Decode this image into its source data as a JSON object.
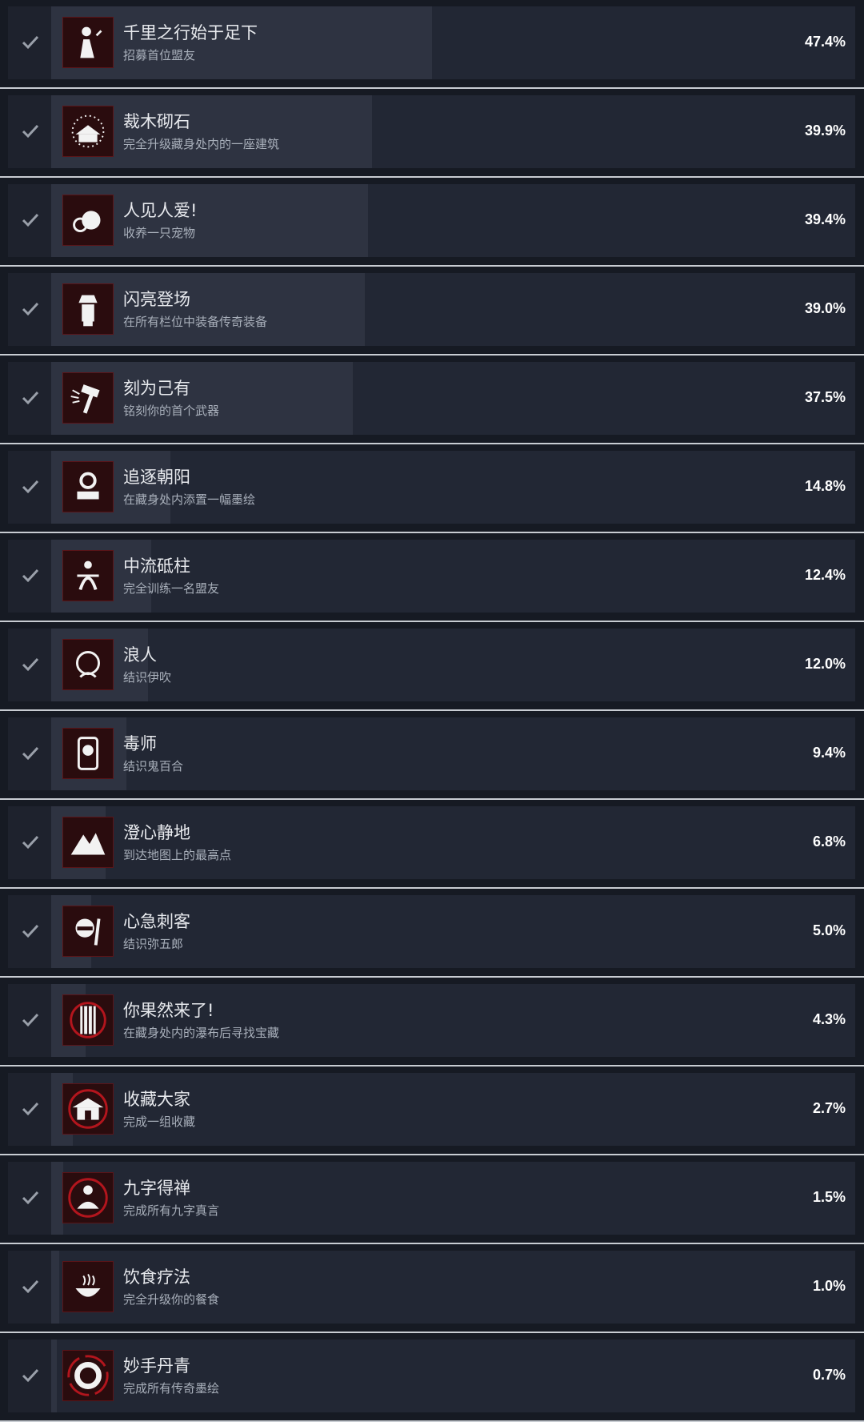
{
  "colors": {
    "row_background": "#161a23",
    "bar_track": "#222734",
    "bar_fill": "#2e3341",
    "icon_background": "#2a0c0e",
    "icon_accent": "#b3151d",
    "separator": "#c8ccd2",
    "title_text": "#e8eaee",
    "description_text": "#a9b0bb",
    "percent_text": "#ffffff"
  },
  "achievements": [
    {
      "title": "千里之行始于足下",
      "description": "招募首位盟友",
      "percent_label": "47.4%",
      "percent": 47.4,
      "icon": "recruit-figure-icon",
      "unlocked": true
    },
    {
      "title": "裁木砌石",
      "description": "完全升级藏身处内的一座建筑",
      "percent_label": "39.9%",
      "percent": 39.9,
      "icon": "building-upgrade-icon",
      "unlocked": true
    },
    {
      "title": "人见人爱!",
      "description": "收养一只宠物",
      "percent_label": "39.4%",
      "percent": 39.4,
      "icon": "pet-icon",
      "unlocked": true
    },
    {
      "title": "闪亮登场",
      "description": "在所有栏位中装备传奇装备",
      "percent_label": "39.0%",
      "percent": 39.0,
      "icon": "samurai-armor-icon",
      "unlocked": true
    },
    {
      "title": "刻为己有",
      "description": "铭刻你的首个武器",
      "percent_label": "37.5%",
      "percent": 37.5,
      "icon": "hammer-icon",
      "unlocked": true
    },
    {
      "title": "追逐朝阳",
      "description": "在藏身处内添置一幅墨绘",
      "percent_label": "14.8%",
      "percent": 14.8,
      "icon": "painting-icon",
      "unlocked": true
    },
    {
      "title": "中流砥柱",
      "description": "完全训练一名盟友",
      "percent_label": "12.4%",
      "percent": 12.4,
      "icon": "training-icon",
      "unlocked": true
    },
    {
      "title": "浪人",
      "description": "结识伊吹",
      "percent_label": "12.0%",
      "percent": 12.0,
      "icon": "ronin-portrait-icon",
      "unlocked": true
    },
    {
      "title": "毒师",
      "description": "结识鬼百合",
      "percent_label": "9.4%",
      "percent": 9.4,
      "icon": "poisoner-portrait-icon",
      "unlocked": true
    },
    {
      "title": "澄心静地",
      "description": "到达地图上的最高点",
      "percent_label": "6.8%",
      "percent": 6.8,
      "icon": "mountain-icon",
      "unlocked": true
    },
    {
      "title": "心急刺客",
      "description": "结识弥五郎",
      "percent_label": "5.0%",
      "percent": 5.0,
      "icon": "assassin-portrait-icon",
      "unlocked": true
    },
    {
      "title": "你果然来了!",
      "description": "在藏身处内的瀑布后寻找宝藏",
      "percent_label": "4.3%",
      "percent": 4.3,
      "icon": "waterfall-icon",
      "unlocked": true
    },
    {
      "title": "收藏大家",
      "description": "完成一组收藏",
      "percent_label": "2.7%",
      "percent": 2.7,
      "icon": "shrine-icon",
      "unlocked": true
    },
    {
      "title": "九字得禅",
      "description": "完成所有九字真言",
      "percent_label": "1.5%",
      "percent": 1.5,
      "icon": "meditation-icon",
      "unlocked": true
    },
    {
      "title": "饮食疗法",
      "description": "完全升级你的餐食",
      "percent_label": "1.0%",
      "percent": 1.0,
      "icon": "food-bowl-icon",
      "unlocked": true
    },
    {
      "title": "妙手丹青",
      "description": "完成所有传奇墨绘",
      "percent_label": "0.7%",
      "percent": 0.7,
      "icon": "ink-circle-icon",
      "unlocked": true
    }
  ]
}
